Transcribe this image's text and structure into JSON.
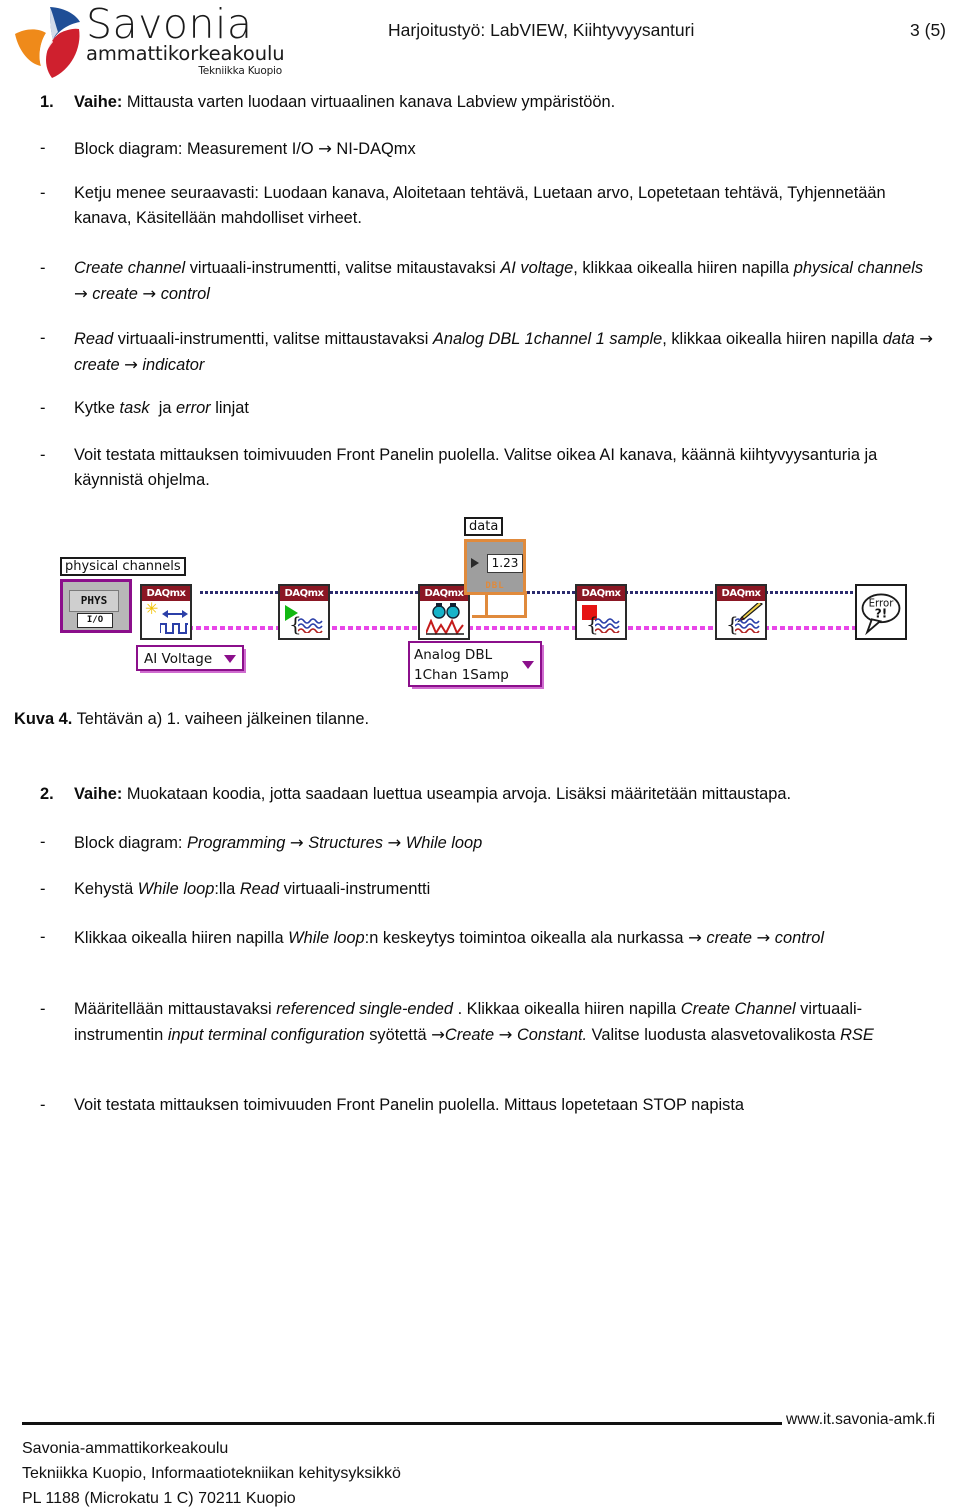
{
  "header": {
    "logo": {
      "name": "Savonia",
      "subtitle": "ammattikorkeakoulu",
      "unit": "Tekniikka Kuopio"
    },
    "title": "Harjoitustyö: LabVIEW, Kiihtyvyysanturi",
    "page": "3 (5)"
  },
  "sections": [
    {
      "number": "1.",
      "label": "Vaihe:",
      "text": " Mittausta varten luodaan virtuaalinen kanava Labview ympäristöön."
    },
    {
      "number": "2.",
      "label": "Vaihe:",
      "text": " Muokataan koodia, jotta saadaan luettua useampia arvoja. Lisäksi määritetään mittaustapa."
    }
  ],
  "bullets_1": [
    "Block diagram: Measurement I/O → NI-DAQmx",
    "Ketju menee seuraavasti: Luodaan kanava, Aloitetaan tehtävä, Luetaan arvo, Lopetetaan tehtävä, Tyhjennetään kanava, Käsitellään mahdolliset virheet.",
    "Create channel virtuaali-instrumentti, valitse mitaustavaksi AI voltage, klikkaa oikealla hiiren napilla physical channels → create → control",
    "Read virtuaali-instrumentti, valitse mittaustavaksi Analog DBL 1channel 1 sample, klikkaa oikealla hiiren napilla data → create → indicator",
    "Kytke task ja error linjat",
    "Voit testata mittauksen toimivuuden Front Panelin puolella. Valitse oikea AI kanava, käännä kiihtyvyysanturia ja käynnistä ohjelma."
  ],
  "bullets_2": [
    "Block diagram: Programming → Structures → While loop",
    "Kehystä While loop:lla Read virtuaali-instrumentti",
    "Klikkaa oikealla hiiren napilla While loop:n keskeytys toimintoa oikealla ala nurkassa → create → control",
    "Määritellään mittaustavaksi referenced single-ended . Klikkaa oikealla hiiren napilla Create Channel virtuaali-instrumentin input terminal configuration syötettä →Create → Constant. Valitse luodusta alasvetovalikosta RSE",
    "Voit testata mittauksen toimivuuden Front Panelin puolella. Mittaus lopetetaan STOP napista"
  ],
  "figure": {
    "caption_bold": "Kuva 4.",
    "caption_rest": " Tehtävän a) 1. vaiheen jälkeinen tilanne.",
    "diagram": {
      "labels": {
        "physical_channels": "physical channels",
        "phys_terminal": "PHYS",
        "phys_io": "I/O",
        "ai_voltage": "AI Voltage",
        "analog_dbl_line1": "Analog DBL",
        "analog_dbl_line2": "1Chan 1Samp",
        "data": "data",
        "data_value": "1.23",
        "data_type": "DBL"
      },
      "nodes": [
        {
          "caption": "DAQmx",
          "role": "create-channel"
        },
        {
          "caption": "DAQmx",
          "role": "start-task"
        },
        {
          "caption": "DAQmx",
          "role": "read"
        },
        {
          "caption": "DAQmx",
          "role": "stop-task"
        },
        {
          "caption": "DAQmx",
          "role": "clear-task"
        }
      ],
      "error_node": {
        "line1": "Error",
        "line2": "?!"
      },
      "colors": {
        "daqmx_caption_bg": "#8b1724",
        "control_border": "#8b0f8b",
        "indicator_border": "#e08a3c",
        "error_wire": "#e846e8",
        "task_wire": "#2b2b6e"
      }
    }
  },
  "footer": {
    "url": "www.it.savonia-amk.fi",
    "lines": [
      "Savonia-ammattikorkeakoulu",
      "Tekniikka Kuopio, Informaatiotekniikan kehitysyksikkö",
      "PL 1188 (Microkatu 1 C) 70211 Kuopio"
    ]
  }
}
